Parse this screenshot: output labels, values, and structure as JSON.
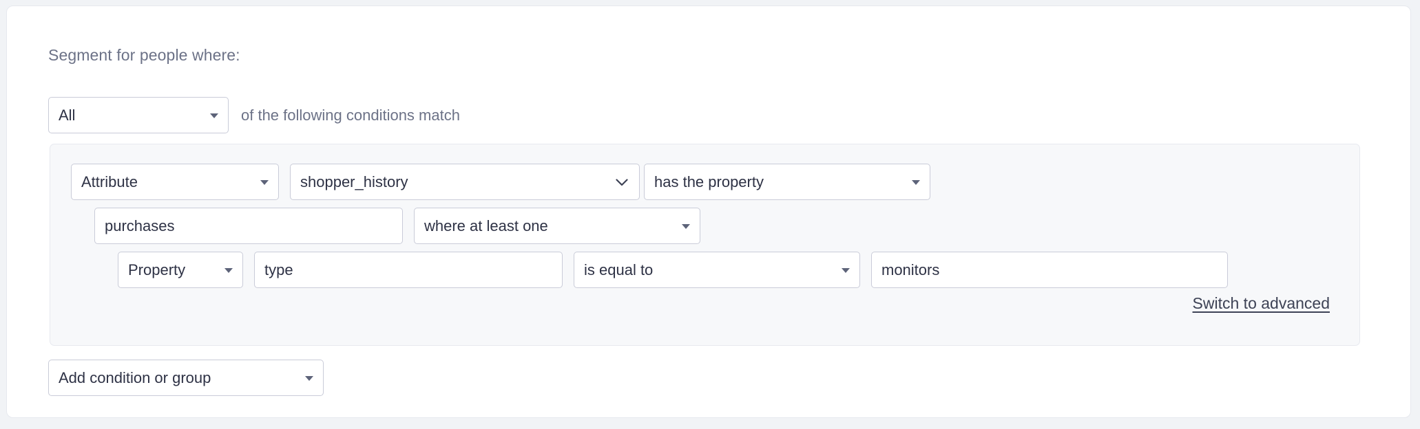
{
  "builder": {
    "heading": "Segment for people where:",
    "match_scope": {
      "value": "All",
      "caret_icon": "caret-down-icon"
    },
    "match_label": "of the following conditions match",
    "conditions": {
      "row1": {
        "kind_select": {
          "value": "Attribute",
          "caret_icon": "caret-down-icon"
        },
        "attribute_select": {
          "value": "shopper_history",
          "caret_icon": "chevron-down-icon"
        },
        "operator_select": {
          "value": "has the property",
          "caret_icon": "caret-down-icon"
        }
      },
      "row2": {
        "property_input": {
          "value": "purchases"
        },
        "quantifier_select": {
          "value": "where at least one",
          "caret_icon": "caret-down-icon"
        }
      },
      "row3": {
        "kind_select": {
          "value": "Property",
          "caret_icon": "caret-down-icon"
        },
        "property_input": {
          "value": "type"
        },
        "comparator_select": {
          "value": "is equal to",
          "caret_icon": "caret-down-icon"
        },
        "value_input": {
          "value": "monitors"
        }
      },
      "switch_link": "Switch to advanced"
    },
    "add_button": {
      "value": "Add condition or group",
      "caret_icon": "caret-down-icon"
    }
  },
  "colors": {
    "page_background": "#f1f3f6",
    "card_background": "#ffffff",
    "panel_background": "#f7f8fa",
    "muted_text": "#6c7287",
    "field_text": "#2e3245",
    "field_border": "#c9cbd8",
    "caret": "#5d6379"
  }
}
